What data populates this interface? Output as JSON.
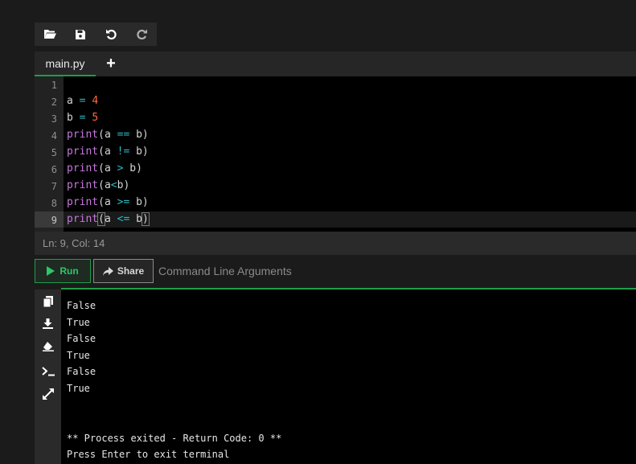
{
  "toolbar": {
    "buttons": [
      {
        "name": "open-folder-icon"
      },
      {
        "name": "save-icon"
      },
      {
        "name": "undo-icon"
      },
      {
        "name": "redo-icon"
      }
    ]
  },
  "tabs": {
    "file_name": "main.py",
    "add_label": "+"
  },
  "editor": {
    "line_numbers": [
      "1",
      "2",
      "3",
      "4",
      "5",
      "6",
      "7",
      "8",
      "9"
    ],
    "active_line": 9
  },
  "status": {
    "position": "Ln: 9,  Col: 14"
  },
  "runbar": {
    "run_label": "Run",
    "share_label": "Share",
    "args_placeholder": "Command Line Arguments"
  },
  "terminal": {
    "output": [
      "False",
      "True",
      "False",
      "True",
      "False",
      "True"
    ],
    "exit_message": "** Process exited - Return Code: 0 **",
    "enter_message": "Press Enter to exit terminal"
  },
  "colors": {
    "accent_green": "#1e9e48",
    "keyword_purple": "#c678dd",
    "number_orange": "#ff6a3d",
    "operator_cyan": "#2bbac5"
  }
}
